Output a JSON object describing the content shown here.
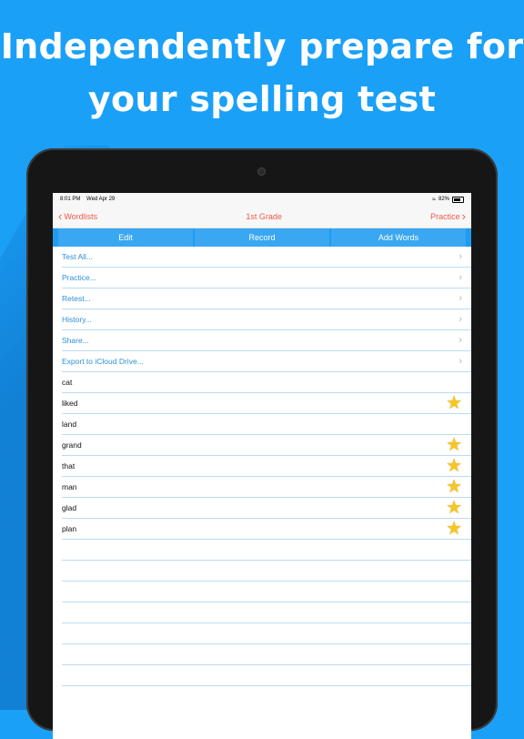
{
  "headline": {
    "line1": "Independently prepare for",
    "line2": "your spelling test"
  },
  "status_bar": {
    "time": "8:01 PM",
    "date": "Wed Apr 29",
    "battery": "82%"
  },
  "nav": {
    "back_label": "Wordlists",
    "title": "1st Grade",
    "forward_label": "Practice"
  },
  "segments": [
    "Edit",
    "Record",
    "Add Words"
  ],
  "actions": [
    {
      "label": "Test All..."
    },
    {
      "label": "Practice..."
    },
    {
      "label": "Retest..."
    },
    {
      "label": "History..."
    },
    {
      "label": "Share..."
    },
    {
      "label": "Export to iCloud Drive..."
    }
  ],
  "words": [
    {
      "text": "cat",
      "starred": false
    },
    {
      "text": "liked",
      "starred": true
    },
    {
      "text": "land",
      "starred": false
    },
    {
      "text": "grand",
      "starred": true
    },
    {
      "text": "that",
      "starred": true
    },
    {
      "text": "man",
      "starred": true
    },
    {
      "text": "glad",
      "starred": true
    },
    {
      "text": "plan",
      "starred": true
    }
  ],
  "empty_rows": 7,
  "colors": {
    "background": "#1aa0f7",
    "nav_tint": "#f05a4b",
    "action_text": "#2f8fd8",
    "segment_bg": "#3aa7f2",
    "star": "#f6c526"
  },
  "icons": {
    "back": "chevron-left-icon",
    "forward": "chevron-right-icon",
    "row_arrow": "chevron-right-icon",
    "star": "star-icon",
    "wifi": "wifi-icon",
    "battery": "battery-icon"
  }
}
